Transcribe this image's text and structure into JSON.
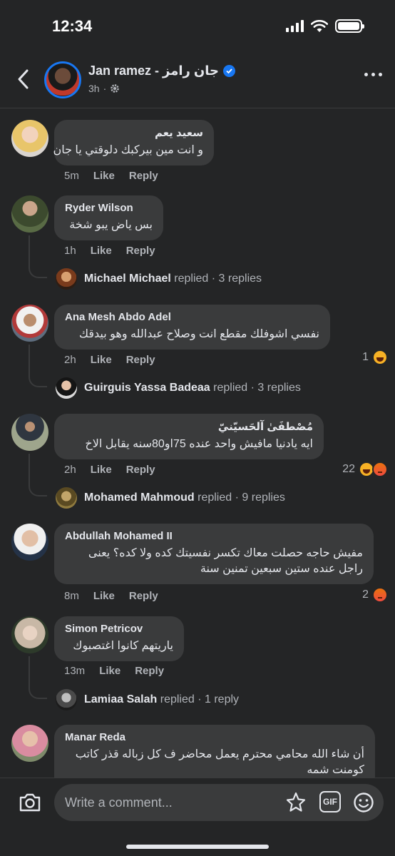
{
  "status_bar": {
    "time": "12:34"
  },
  "header": {
    "name": "Jan ramez - جان رامز",
    "time_ago": "3h",
    "icons": {
      "back": "chevron-left-icon",
      "more": "more-dots-icon",
      "privacy": "gear-icon",
      "verified": "verified-badge-icon"
    }
  },
  "comments": [
    {
      "name": "سعيد يعم",
      "text": [
        "و انت مين بيركبك دلوقتي يا جان"
      ],
      "time": "5m",
      "like": "Like",
      "reply": "Reply"
    },
    {
      "name": "Ryder Wilson",
      "text": [
        "بس ياض يبو شخة"
      ],
      "time": "1h",
      "like": "Like",
      "reply": "Reply",
      "replies": {
        "name": "Michael Michael",
        "verb": "replied",
        "count": "3 replies"
      }
    },
    {
      "name": "Ana Mesh Abdo Adel",
      "text": [
        "نفسي اشوفلك مقطع انت وصلاح عبدالله وهو بيدقك"
      ],
      "time": "2h",
      "like": "Like",
      "reply": "Reply",
      "reaction_count": "1",
      "replies": {
        "name": "Guirguis Yassa Badeaa",
        "verb": "replied",
        "count": "3 replies"
      }
    },
    {
      "name": "مُصْطفَىٰ آلحَسيّنيّ",
      "text": [
        "ايه يادنيا مافيش واحد عنده 75او80سنه يقابل الاخ"
      ],
      "time": "2h",
      "like": "Like",
      "reply": "Reply",
      "reaction_count": "22",
      "replies": {
        "name": "Mohamed Mahmoud",
        "verb": "replied",
        "count": "9 replies"
      }
    },
    {
      "name": "Abdullah Mohamed II",
      "text": [
        "مفيش حاجه حصلت معاك تكسر نفسيتك كده ولا كده؟ يعنى",
        "راجل عنده ستين سبعين تمنين سنة"
      ],
      "time": "8m",
      "like": "Like",
      "reply": "Reply",
      "reaction_count": "2"
    },
    {
      "name": "Simon Petricov",
      "text": [
        "ياريتهم كانوا اغتصبوك"
      ],
      "time": "13m",
      "like": "Like",
      "reply": "Reply",
      "replies": {
        "name": "Lamiaa Salah",
        "verb": "replied",
        "count": "1 reply"
      }
    },
    {
      "name": "Manar Reda",
      "text": [
        "أن شاء الله محامي محترم يعمل محاضر ف كل زباله قذر كاتب",
        "كومنت شمه"
      ]
    }
  ],
  "separator": "·",
  "composer": {
    "placeholder": "Write a comment...",
    "gif_label": "GIF",
    "icons": {
      "camera": "camera-icon",
      "sticker": "sticker-icon",
      "gif": "gif-icon",
      "emoji": "emoji-icon"
    }
  },
  "colors": {
    "background": "#242526",
    "bubble": "#3a3b3c",
    "accent": "#1877f2",
    "secondary_text": "#b0b3b8"
  }
}
